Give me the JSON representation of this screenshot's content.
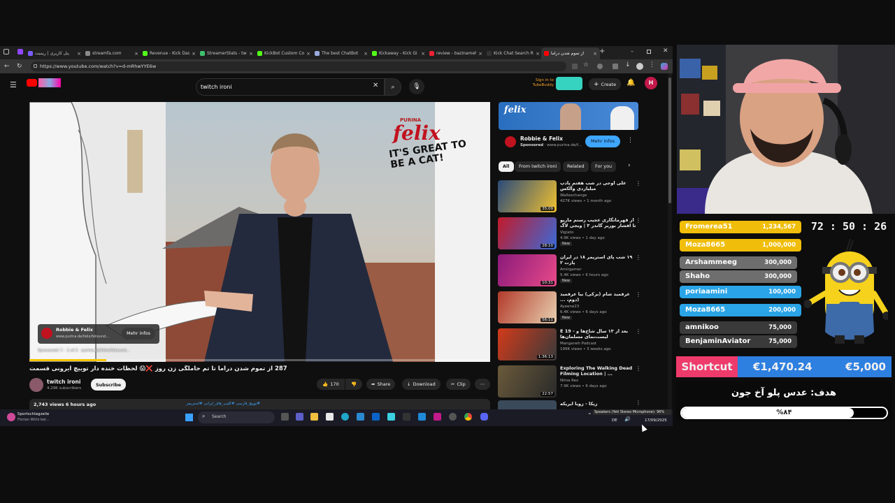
{
  "browser": {
    "tabs": [
      {
        "label": "پنل کاربری | ریمیت",
        "color": "#7b5cff"
      },
      {
        "label": "streamfa.com",
        "color": "#8a8a8a"
      },
      {
        "label": "Revenue - Kick Das",
        "color": "#53fc18"
      },
      {
        "label": "StreamerStats - twi",
        "color": "#3fbf6e"
      },
      {
        "label": "KickBot Custom Co",
        "color": "#53fc18"
      },
      {
        "label": "The best ChatBot",
        "color": "#9ad"
      },
      {
        "label": "Kickaway - Kick Gi",
        "color": "#53fc18"
      },
      {
        "label": "review - bazinameh",
        "color": "#e23"
      },
      {
        "label": "Kick Chat Search R",
        "color": "#333"
      },
      {
        "label": "از تموم شدن دراما",
        "color": "#ff0000"
      }
    ],
    "url": "https://www.youtube.com/watch?v=d-mRhwYYE6w"
  },
  "youtube": {
    "search_query": "twitch ironi",
    "create_label": "Create",
    "avatar_letter": "H",
    "signin_label": "Sign in to TubeBuddy",
    "video_title": "287 از تموم شدن دراما تا تم حاملگی زن روز ❌😱 لحظات خنده دار توییچ ایرونی قسمت",
    "channel_name": "twitch ironi",
    "subscribers": "4.29K subscribers",
    "subscribe_label": "Subscribe",
    "likes": "170",
    "share_label": "Share",
    "download_label": "Download",
    "clip_label": "Clip",
    "views_line": "2,743 views 6 hours ago",
    "hashtags": "#توییچ_فارسی #کلیپ_های_ایرانی #استریمر",
    "ad": {
      "brand": "PURINA",
      "logo": "felix",
      "slogan": "IT'S GREAT TO BE A CAT!",
      "overlay_name": "Robbie & Felix",
      "overlay_url": "www.purina.de/felix/felixund...",
      "overlay_button": "Mehr infos",
      "sponsored": "Sponsored",
      "count": "1 of 2",
      "url_footer": "purina.de/felix/felixund..."
    },
    "side_ad": {
      "title": "Robbie & Felix",
      "sponsored": "Sponsored",
      "url": "www.purina.de/f...",
      "button": "Mehr infos"
    },
    "chips": [
      "All",
      "From twitch ironi",
      "Related",
      "For you"
    ],
    "recommendations": [
      {
        "title": "علی اوجی در شب هفتم پادپ میلیاردی وآلکس",
        "channel": "Wallexchange",
        "meta": "427K views • 1 month ago",
        "duration": "35:09",
        "new": "",
        "thumb": [
          "#2a4a7a",
          "#f0c030"
        ]
      },
      {
        "title": "از قهرمانگاری عجیب رستم ماریو تا افشار بوربر گاندر ۳ | ویجی لاگ پلاس",
        "channel": "Vigiato",
        "meta": "4.9K views • 1 day ago",
        "duration": "28:10",
        "new": "New",
        "thumb": [
          "#c21a2a",
          "#3a6ad8"
        ]
      },
      {
        "title": "۱۹ شب پای استریمر ۱۸ در ایران پارت ۲",
        "channel": "Amirgamer",
        "meta": "5.4K views • 6 hours ago",
        "duration": "10:31",
        "new": "New",
        "thumb": [
          "#8a1a7a",
          "#e84a8a"
        ]
      },
      {
        "title": "عرفمید شام (بزکی) بیا عرفمید (دوم، ...",
        "channel": "Ayeene23",
        "meta": "6.4K views • 6 days ago",
        "duration": "56:11",
        "new": "New",
        "thumb": [
          "#b23a2a",
          "#e8d0b0"
        ]
      },
      {
        "title": "E 19 - بعد از ۱۳ سال شاخ‌ها و لیست‌نمای مسلمان‌ها",
        "channel": "Manganeh Podcast",
        "meta": "199K views • 3 weeks ago",
        "duration": "1:36:13",
        "new": "",
        "thumb": [
          "#d23a1a",
          "#3a3a3a"
        ]
      },
      {
        "title": "Exploring The Walking Dead Filming Location | ...",
        "channel": "Nima Rez",
        "meta": "7.9K views • 6 days ago",
        "duration": "22:57",
        "new": "",
        "thumb": [
          "#6a5a3a",
          "#2a2a2a"
        ]
      }
    ],
    "last_rec_title": "زیکا - زوبا ایریکه"
  },
  "taskbar": {
    "news_title": "Sportschlagzeile",
    "news_sub": "Florian Wirtz bei...",
    "search_label": "Search",
    "speakers": "Speakers (Yeti Stereo Microphone): 96%",
    "lang": "DE",
    "date": "17/09/2025"
  },
  "overlay": {
    "donations": [
      {
        "name": "Fromerea51",
        "amount": "1,234,567",
        "color": "#f0bd0a"
      },
      {
        "name": "Moza8665",
        "amount": "1,000,000",
        "color": "#f0bd0a"
      },
      {
        "name": "Arshammeeg",
        "amount": "300,000",
        "color": "#6e6e6e"
      },
      {
        "name": "Shaho",
        "amount": "300,000",
        "color": "#6e6e6e"
      },
      {
        "name": "poriaamini",
        "amount": "100,000",
        "color": "#2aa4e6"
      },
      {
        "name": "Moza8665",
        "amount": "200,000",
        "color": "#2aa4e6"
      },
      {
        "name": "amnikoo",
        "amount": "75,000",
        "color": "#3a3a3a"
      },
      {
        "name": "BenjaminAviator",
        "amount": "75,000",
        "color": "#3a3a3a"
      }
    ],
    "timer": "72 : 50 : 26",
    "shortcut_label": "Shortcut",
    "shortcut_current": "€1,470.24",
    "shortcut_goal": "€5,000",
    "goal_title": "هدف: عدس پلو آخ جون",
    "goal_percent_text": "%۸۴",
    "goal_fraction": 0.84
  }
}
